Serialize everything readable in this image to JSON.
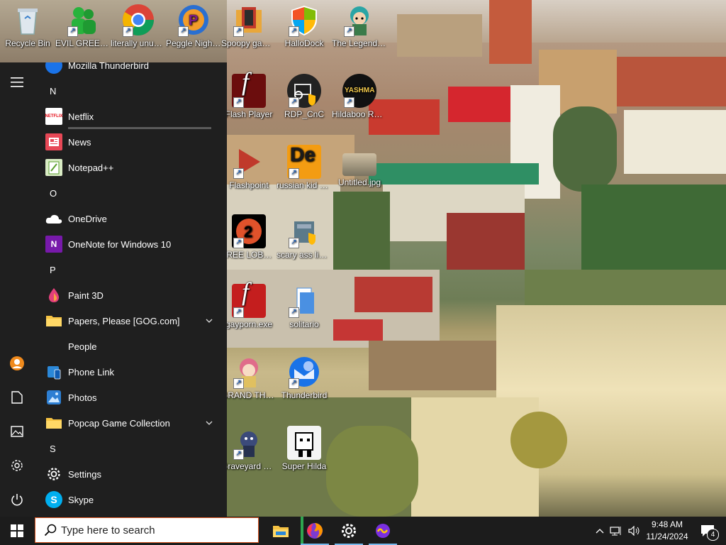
{
  "desktop": {
    "icons": [
      {
        "label": "Recycle Bin"
      },
      {
        "label": "EVIL GREEN MEN GO..."
      },
      {
        "label": "literally unusable"
      },
      {
        "label": "Peggle Nights Deluxe"
      },
      {
        "label": "Spoopy games"
      },
      {
        "label": "HalloDock"
      },
      {
        "label": "The Legend of Zilda"
      },
      {
        "label": "Flash Player"
      },
      {
        "label": "RDP_CnC"
      },
      {
        "label": "Hildaboo Ransomwa..."
      },
      {
        "label": "Flashpoint"
      },
      {
        "label": "russian kid opened a rat"
      },
      {
        "label": "Untitled.jpg"
      },
      {
        "label": "FREE LOBOTOMYS"
      },
      {
        "label": "scary ass library"
      },
      {
        "label": "gayporn.exe"
      },
      {
        "label": "solitario"
      },
      {
        "label": "GRAND THEFT AU..."
      },
      {
        "label": "Thunderbird"
      },
      {
        "label": "Graveyard Party Scre..."
      },
      {
        "label": "Super Hilda"
      }
    ],
    "icon_badges": {
      "yashma": "YASHMA",
      "de": "De",
      "free_num": "2",
      "flash_letter": "f"
    }
  },
  "start_menu": {
    "partial_top_item": "Mozilla Thunderbird",
    "rail_icons": [
      "hamburger-icon",
      "user-avatar-icon",
      "documents-icon",
      "pictures-icon",
      "settings-gear-icon",
      "power-icon"
    ],
    "rows": [
      {
        "kind": "letter",
        "text": "N"
      },
      {
        "kind": "app",
        "text": "Netflix",
        "icon": "netflix-icon",
        "icon_text": "NETFLIX"
      },
      {
        "kind": "app",
        "text": "News",
        "icon": "news-icon"
      },
      {
        "kind": "app",
        "text": "Notepad++",
        "icon": "notepadpp-icon"
      },
      {
        "kind": "letter",
        "text": "O"
      },
      {
        "kind": "app",
        "text": "OneDrive",
        "icon": "onedrive-icon"
      },
      {
        "kind": "app",
        "text": "OneNote for Windows 10",
        "icon": "onenote-icon",
        "icon_text": "N"
      },
      {
        "kind": "letter",
        "text": "P"
      },
      {
        "kind": "app",
        "text": "Paint 3D",
        "icon": "paint3d-icon"
      },
      {
        "kind": "folder",
        "text": "Papers, Please [GOG.com]",
        "icon": "folder-icon"
      },
      {
        "kind": "app",
        "text": "People",
        "icon": "people-icon"
      },
      {
        "kind": "app",
        "text": "Phone Link",
        "icon": "phone-link-icon"
      },
      {
        "kind": "app",
        "text": "Photos",
        "icon": "photos-icon"
      },
      {
        "kind": "folder",
        "text": "Popcap Game Collection",
        "icon": "folder-icon"
      },
      {
        "kind": "letter",
        "text": "S"
      },
      {
        "kind": "app",
        "text": "Settings",
        "icon": "settings-icon"
      },
      {
        "kind": "app",
        "text": "Skype",
        "icon": "skype-icon",
        "icon_text": "S"
      }
    ]
  },
  "taskbar": {
    "search_placeholder": "Type here to search",
    "pinned": [
      "file-explorer-icon",
      "firefox-icon",
      "settings-gear-icon",
      "meta-app-icon"
    ],
    "tray": {
      "time": "9:48 AM",
      "date": "11/24/2024",
      "notification_count": "4"
    }
  },
  "colors": {
    "accent": "#76b9ed",
    "start_bg": "#1f1f1f",
    "taskbar_bg": "#1c1c1c",
    "search_border": "#d9531e"
  }
}
